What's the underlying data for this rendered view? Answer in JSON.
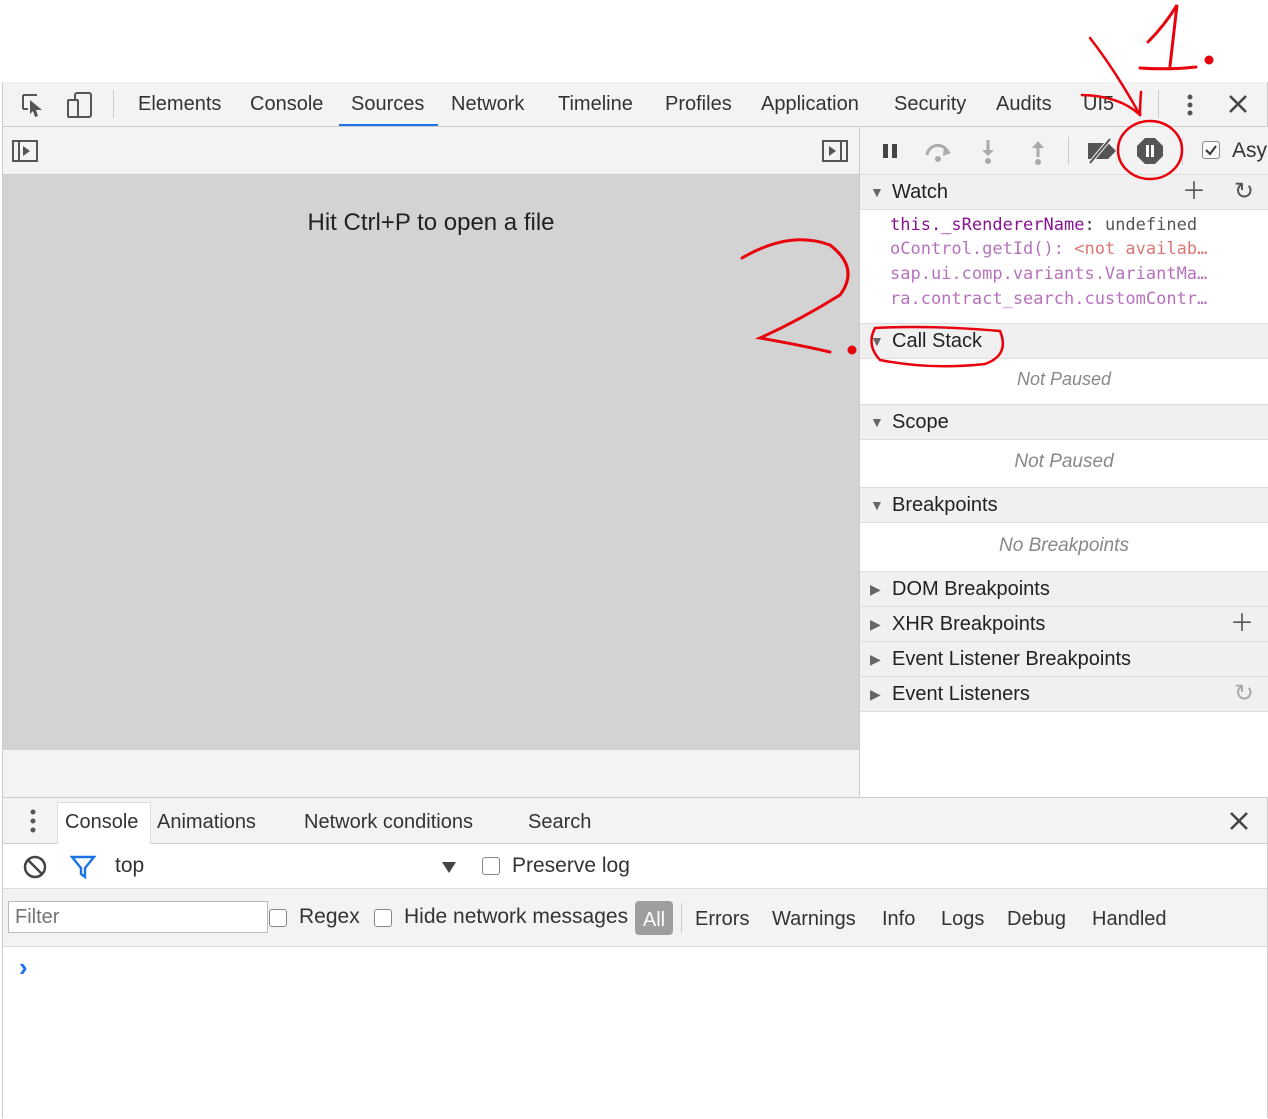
{
  "main_tabs": [
    "Elements",
    "Console",
    "Sources",
    "Network",
    "Timeline",
    "Profiles",
    "Application",
    "Security",
    "Audits",
    "UI5"
  ],
  "active_tab": "Sources",
  "editor": {
    "hint": "Hit Ctrl+P to open a file"
  },
  "debugger": {
    "async_label": "Asy",
    "watch": {
      "title": "Watch",
      "expressions": [
        {
          "name": "this._sRendererName",
          "sep": ": ",
          "value": "undefined"
        },
        {
          "name": "oControl.getId()",
          "sep": ": ",
          "value": "<not availab…"
        },
        {
          "name": "sap.ui.comp.variants.VariantMa…",
          "sep": "",
          "value": ""
        },
        {
          "name": "ra.contract_search.customContr…",
          "sep": "",
          "value": ""
        }
      ]
    },
    "call_stack": {
      "title": "Call Stack",
      "status": "Not Paused"
    },
    "scope": {
      "title": "Scope",
      "status": "Not Paused"
    },
    "breakpoints": {
      "title": "Breakpoints",
      "status": "No Breakpoints"
    },
    "collapsed_panes": [
      "DOM Breakpoints",
      "XHR Breakpoints",
      "Event Listener Breakpoints",
      "Event Listeners"
    ]
  },
  "drawer": {
    "tabs": [
      "Console",
      "Animations",
      "Network conditions",
      "Search"
    ],
    "active_tab": "Console",
    "context": "top",
    "preserve_log": "Preserve log",
    "filter_placeholder": "Filter",
    "regex": "Regex",
    "hide_network": "Hide network messages",
    "levels": [
      "All",
      "Errors",
      "Warnings",
      "Info",
      "Logs",
      "Debug",
      "Handled"
    ],
    "prompt": "›"
  },
  "annotations": {
    "one": "1.",
    "two": "2."
  },
  "colors": {
    "accent": "#1a73e8",
    "annotation": "#e8000b",
    "watch_name": "#881391",
    "watch_error": "#c41a16"
  }
}
